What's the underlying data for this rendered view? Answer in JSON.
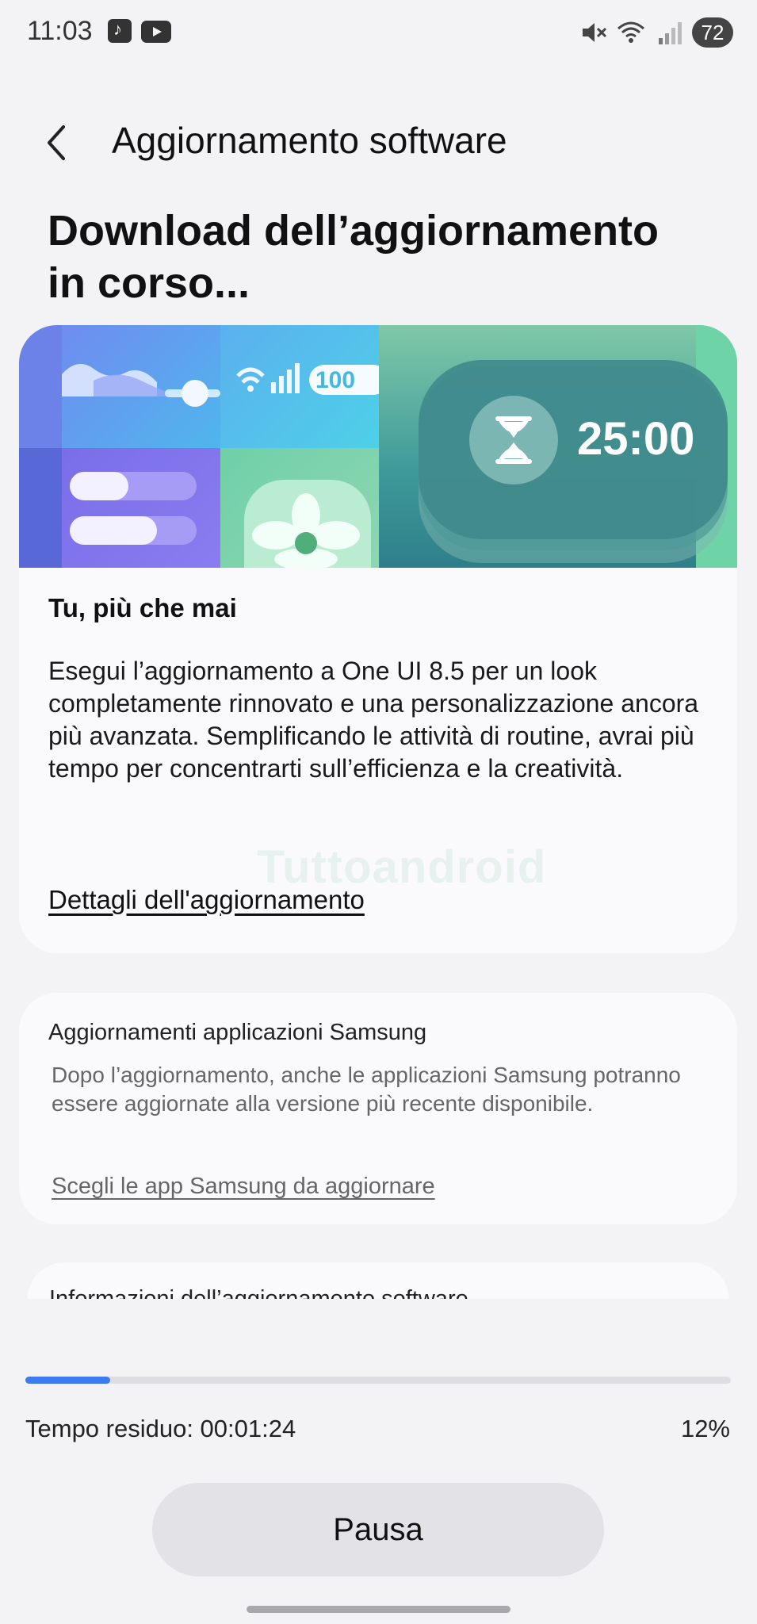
{
  "status_bar": {
    "time": "11:03",
    "battery": "72",
    "icons": [
      "music-app-icon",
      "youtube-icon",
      "mute-icon",
      "wifi-icon",
      "signal-icon",
      "battery-icon"
    ]
  },
  "header": {
    "title": "Aggiornamento software",
    "back_icon": "chevron-left-icon"
  },
  "heading": "Download dell’aggiornamento in corso...",
  "main_card": {
    "banner": {
      "battery_text": "100",
      "timer_text": "25:00"
    },
    "title": "Tu, più che mai",
    "body": "Esegui l’aggiornamento a One UI 8.5 per un look completamente rinnovato e una personalizzazione ancora più avanzata. Semplificando le attività di routine, avrai più tempo per concentrarti sull’efficienza e la creatività.",
    "link": "Dettagli dell'aggiornamento",
    "watermark": "Tuttoandroid"
  },
  "apps_card": {
    "title": "Aggiornamenti applicazioni Samsung",
    "body": "Dopo l’aggiornamento, anche le applicazioni Samsung potranno essere aggiornate alla versione più recente disponibile.",
    "link": "Scegli le app Samsung da aggiornare"
  },
  "info_card": {
    "title": "Informazioni dell’aggiornamento software"
  },
  "progress": {
    "fraction": 0.12,
    "time_left": "Tempo residuo: 00:01:24",
    "percent": "12%"
  },
  "pause_label": "Pausa",
  "colors": {
    "background": "#f3f3f5",
    "card": "#fafafd",
    "accent": "#3d7cf0",
    "button": "#e3e3e7"
  }
}
